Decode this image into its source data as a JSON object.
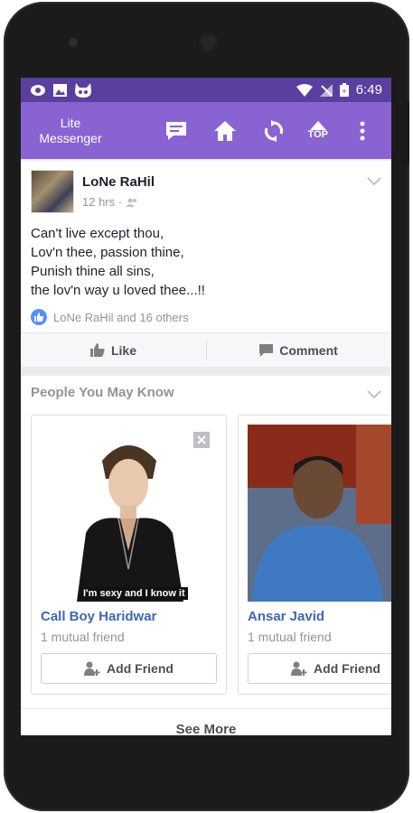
{
  "statusbar": {
    "time": "6:49"
  },
  "appbar": {
    "title_line1": "Lite",
    "title_line2": "Messenger",
    "top_label": "TOP"
  },
  "post": {
    "author": "LoNe RaHil",
    "time": "12 hrs ·",
    "lines": [
      "Can't live except thou,",
      "Lov'n thee, passion thine,",
      "Punish thine all sins,",
      "the lov'n way u loved thee...!!"
    ],
    "likes": "LoNe RaHil and 16 others",
    "like_label": "Like",
    "comment_label": "Comment"
  },
  "pymk": {
    "title": "People You May Know",
    "people": [
      {
        "name": "Call Boy Haridwar",
        "mutual": "1 mutual friend",
        "add_label": "Add Friend",
        "photo_caption": "I'm sexy and I know it"
      },
      {
        "name": "Ansar Javid",
        "mutual": "1 mutual friend",
        "add_label": "Add Friend"
      }
    ],
    "see_more": "See More"
  },
  "colors": {
    "statusbar": "#5b3f9e",
    "appbar": "#8a63d2",
    "link": "#4267b2",
    "like_badge": "#5890ff"
  }
}
